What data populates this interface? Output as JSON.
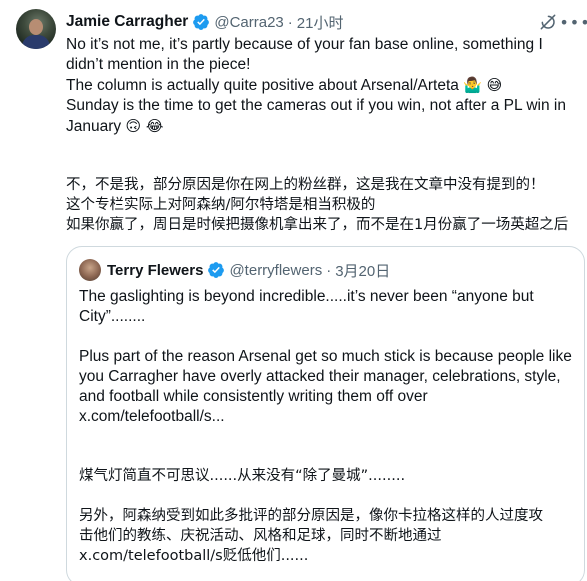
{
  "tweet": {
    "author_name": "Jamie Carragher",
    "handle": "@Carra23",
    "separator": "·",
    "time": "21小时",
    "text_lines": [
      "No it’s not me, it’s partly because of your fan base online, something I",
      "didn’t mention in the piece!",
      "The column is actually quite positive about Arsenal/Arteta",
      "Sunday is the time to get the cameras out if you win, not after a PL win in",
      "January"
    ],
    "emojis_line3": "🤷‍♂️ 😅",
    "emojis_line5": "🙃 😂",
    "translation_lines": [
      "不，不是我，部分原因是你在网上的粉丝群，这是我在文章中没有提到的！",
      "这个专栏实际上对阿森纳/阿尔特塔是相当积极的",
      "如果你赢了，周日是时候把摄像机拿出来了，而不是在1月份赢了一场英超之后"
    ]
  },
  "quoted_tweet": {
    "author_name": "Terry Flewers",
    "handle": "@terryflewers",
    "separator": "·",
    "date": "3月20日",
    "paragraph1": [
      "The gaslighting is beyond incredible.....it’s never been “anyone but",
      "City”........"
    ],
    "paragraph2": [
      "Plus part of the reason Arsenal get so much stick is because people like",
      "you Carragher have overly attacked their manager, celebrations, style,",
      "and football while consistently writing them off over",
      "x.com/telefootball/s..."
    ],
    "paragraph3": [
      "煤气灯简直不可思议......从来没有“除了曼城”........"
    ],
    "paragraph4": [
      "另外，阿森纳受到如此多批评的部分原因是，像你卡拉格这样的人过度攻",
      "击他们的教练、庆祝活动、风格和足球，同时不断地通过",
      "x.com/telefootball/s贬低他们......"
    ]
  },
  "colors": {
    "text": "#0f1419",
    "secondary": "#536471",
    "verified_blue": "#1d9bf0",
    "border": "#cfd9de"
  },
  "icons": {
    "verified": "verified-badge-icon",
    "grok": "grok-icon",
    "more": "more-options-icon"
  }
}
